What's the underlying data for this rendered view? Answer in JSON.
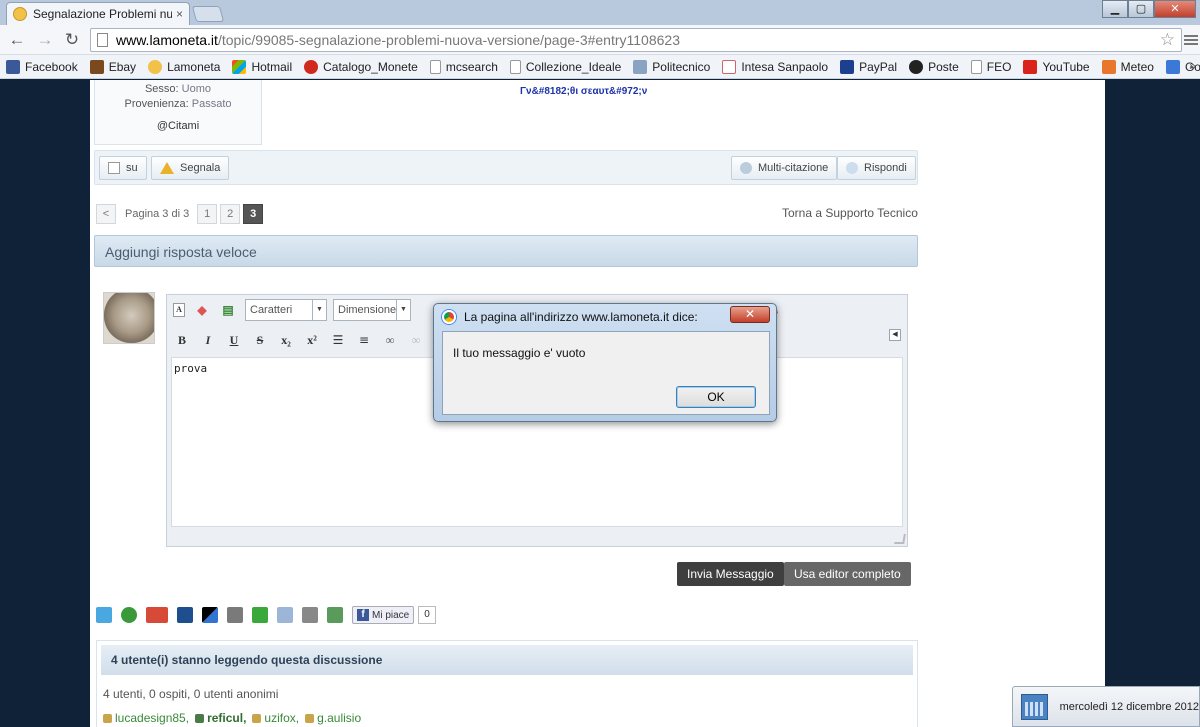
{
  "browser": {
    "tab_title": "Segnalazione Problemi nu",
    "tab_close": "×",
    "url_host": "www.lamoneta.it",
    "url_path": "/topic/99085-segnalazione-problemi-nuova-versione/page-3#entry1108623",
    "window_controls": {
      "minimize": "▁",
      "maximize": "▢",
      "close": "✕"
    },
    "bookmarks": [
      "Facebook",
      "Ebay",
      "Lamoneta",
      "Hotmail",
      "Catalogo_Monete",
      "mcsearch",
      "Collezione_Ideale",
      "Politecnico",
      "Intesa Sanpaolo",
      "PayPal",
      "Poste",
      "FEO",
      "YouTube",
      "Meteo",
      "Google"
    ],
    "bookmarks_more": "»"
  },
  "profile": {
    "sex_label": "Sesso:",
    "sex_value": "Uomo",
    "origin_label": "Provenienza:",
    "origin_value": "Passato",
    "cite": "@Citami",
    "signature": "Γν&#8182;θι σεαυτ&#972;ν"
  },
  "post_actions": {
    "up": "su",
    "report": "Segnala",
    "multiquote": "Multi-citazione",
    "reply": "Rispondi"
  },
  "pagination": {
    "prev": "<",
    "label": "Pagina 3 di 3",
    "pages": [
      "1",
      "2",
      "3"
    ],
    "back_link": "Torna a Supporto Tecnico"
  },
  "quick_reply": {
    "title": "Aggiungi risposta veloce",
    "font_select": "Caratteri",
    "size_select": "Dimensione",
    "content": "prova",
    "send_button": "Invia Messaggio",
    "full_editor_button": "Usa editor completo"
  },
  "social": {
    "like_label": "Mi piace",
    "like_count": "0"
  },
  "readers": {
    "title": "4 utente(i) stanno leggendo questa discussione",
    "summary": "4 utenti, 0 ospiti, 0 utenti anonimi",
    "users": [
      "lucadesign85,",
      "reficul,",
      "uzifox,",
      "g.aulisio"
    ]
  },
  "dialog": {
    "title": "La pagina all'indirizzo www.lamoneta.it dice:",
    "message": "Il tuo messaggio e' vuoto",
    "ok": "OK",
    "close": "✕"
  },
  "taskbar": {
    "date": "mercoledì 12 dicembre 2012"
  }
}
